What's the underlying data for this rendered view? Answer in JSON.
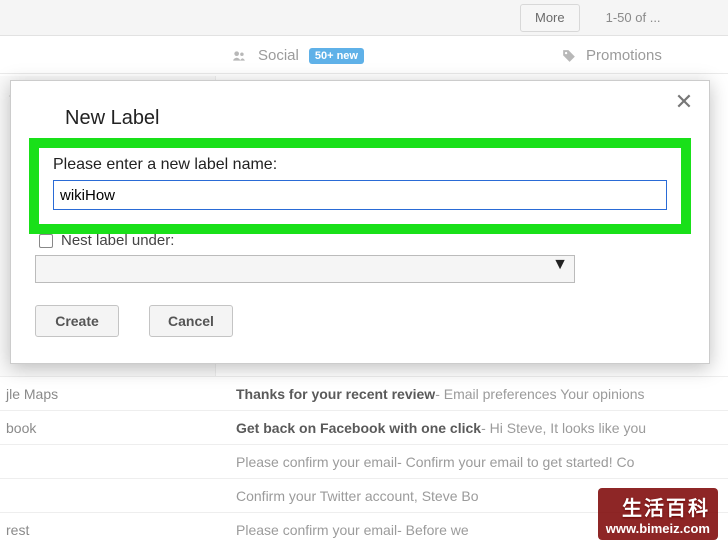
{
  "topbar": {
    "more_label": "More",
    "counter": "1-50 of ..."
  },
  "tabs": {
    "social_label": "Social",
    "social_badge": "50+ new",
    "promotions_label": "Promotions"
  },
  "sidebar": {
    "items": [
      "jle Maps",
      "book",
      "",
      "",
      "rest"
    ]
  },
  "modal": {
    "title": "New Label",
    "close_glyph": "✕",
    "input_label": "Please enter a new label name:",
    "input_value": "wikiHow",
    "nest_label": "Nest label under:",
    "nest_select_glyph": "▼",
    "create_label": "Create",
    "cancel_label": "Cancel"
  },
  "emails": [
    {
      "sender": "jle Maps",
      "subject": "Thanks for your recent review",
      "snippet": " - Email preferences Your opinions",
      "read": false
    },
    {
      "sender": "book",
      "subject": "Get back on Facebook with one click",
      "snippet": " - Hi Steve, It looks like you",
      "read": false
    },
    {
      "sender": "",
      "subject": "Please confirm your email",
      "snippet": " - Confirm your email to get started! Co",
      "read": true
    },
    {
      "sender": "",
      "subject": "Confirm your Twitter account, Steve Bo",
      "snippet": "",
      "read": true
    },
    {
      "sender": "rest",
      "subject": "Please confirm your email",
      "snippet": " - Before we",
      "read": true
    }
  ],
  "watermark": {
    "title": "生活百科",
    "url": "www.bimeiz.com"
  }
}
